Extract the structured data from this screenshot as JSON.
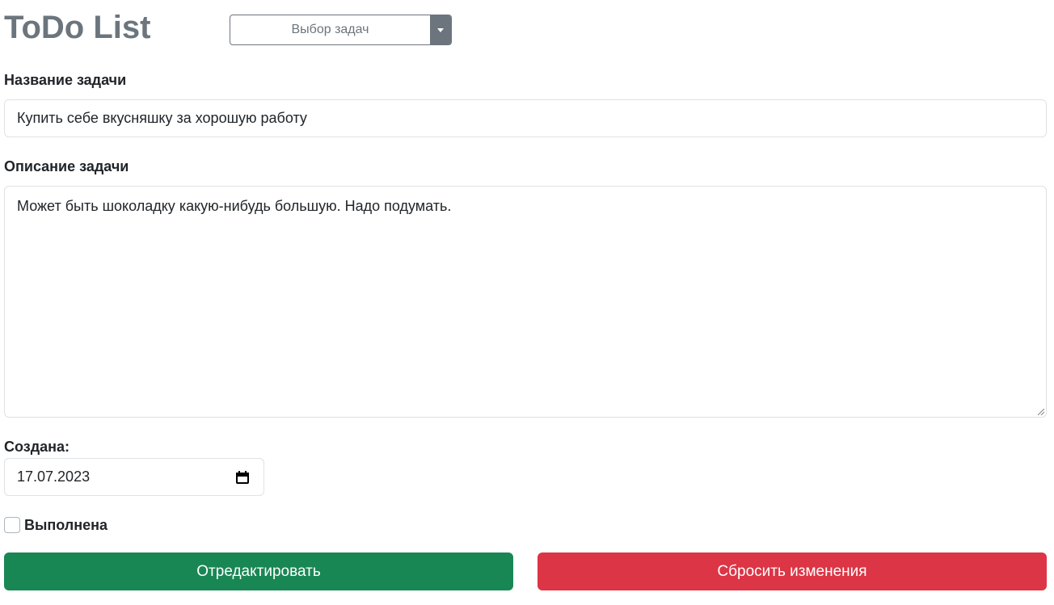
{
  "app": {
    "title": "ToDo List"
  },
  "task_selector": {
    "label": "Выбор задач",
    "icon": "caret-down-icon"
  },
  "form": {
    "name_label": "Название задачи",
    "name_value": "Купить себе вкусняшку за хорошую работу",
    "description_label": "Описание задачи",
    "description_value": "Может быть шоколадку какую-нибудь большую. Надо подумать.",
    "created_label": "Создана:",
    "created_value": "17.07.2023",
    "completed_label": "Выполнена",
    "completed_checked": false
  },
  "buttons": {
    "edit_label": "Отредактировать",
    "reset_label": "Сбросить изменения"
  },
  "colors": {
    "title": "#6c757d",
    "edit_button": "#198754",
    "reset_button": "#dc3545",
    "select_toggle": "#6c757d"
  }
}
